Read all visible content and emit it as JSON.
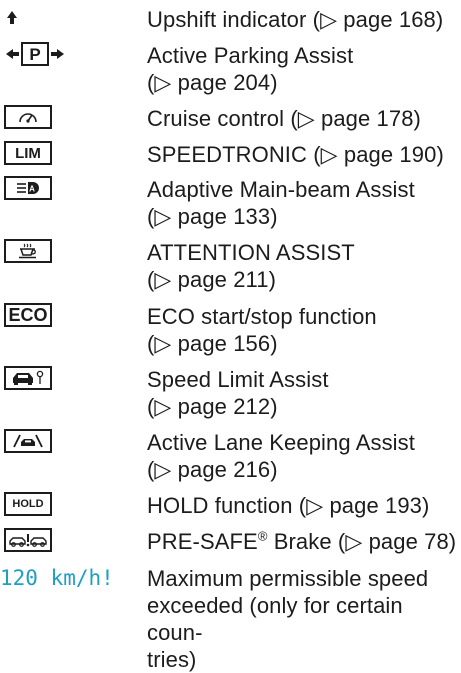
{
  "entries": [
    {
      "icon": "upshift-arrow-icon",
      "lines": [
        "Upshift indicator (▷ page 168)"
      ]
    },
    {
      "icon": "active-parking-assist-icon",
      "icon_text": "P",
      "lines": [
        "Active Parking Assist",
        "(▷ page 204)"
      ]
    },
    {
      "icon": "cruise-control-icon",
      "lines": [
        "Cruise control (▷ page 178)"
      ]
    },
    {
      "icon": "speedtronic-icon",
      "icon_text": "LIM",
      "lines": [
        "SPEEDTRONIC (▷ page 190)"
      ]
    },
    {
      "icon": "adaptive-main-beam-icon",
      "icon_text": "A",
      "lines": [
        "Adaptive Main-beam Assist",
        "(▷ page 133)"
      ]
    },
    {
      "icon": "attention-assist-icon",
      "lines": [
        "ATTENTION ASSIST",
        "(▷ page 211)"
      ]
    },
    {
      "icon": "eco-icon",
      "icon_text": "ECO",
      "lines": [
        "ECO start/stop function",
        "(▷ page 156)"
      ]
    },
    {
      "icon": "speed-limit-assist-icon",
      "lines": [
        "Speed Limit Assist",
        "(▷ page 212)"
      ]
    },
    {
      "icon": "active-lane-keeping-icon",
      "lines": [
        "Active Lane Keeping Assist",
        "(▷ page 216)"
      ]
    },
    {
      "icon": "hold-icon",
      "icon_text": "HOLD",
      "lines": [
        "HOLD function (▷ page 193)"
      ]
    },
    {
      "icon": "pre-safe-brake-icon",
      "line_pre": "PRE-SAFE",
      "line_sup": "®",
      "line_post": " Brake (▷ page 78)"
    },
    {
      "speed_label": "120 km/h!",
      "lines": [
        "Maximum permissible speed",
        "exceeded (only for certain coun-",
        "tries)"
      ]
    }
  ],
  "colors": {
    "text": "#1c1c1c",
    "speed_label": "#1e9fc2"
  }
}
